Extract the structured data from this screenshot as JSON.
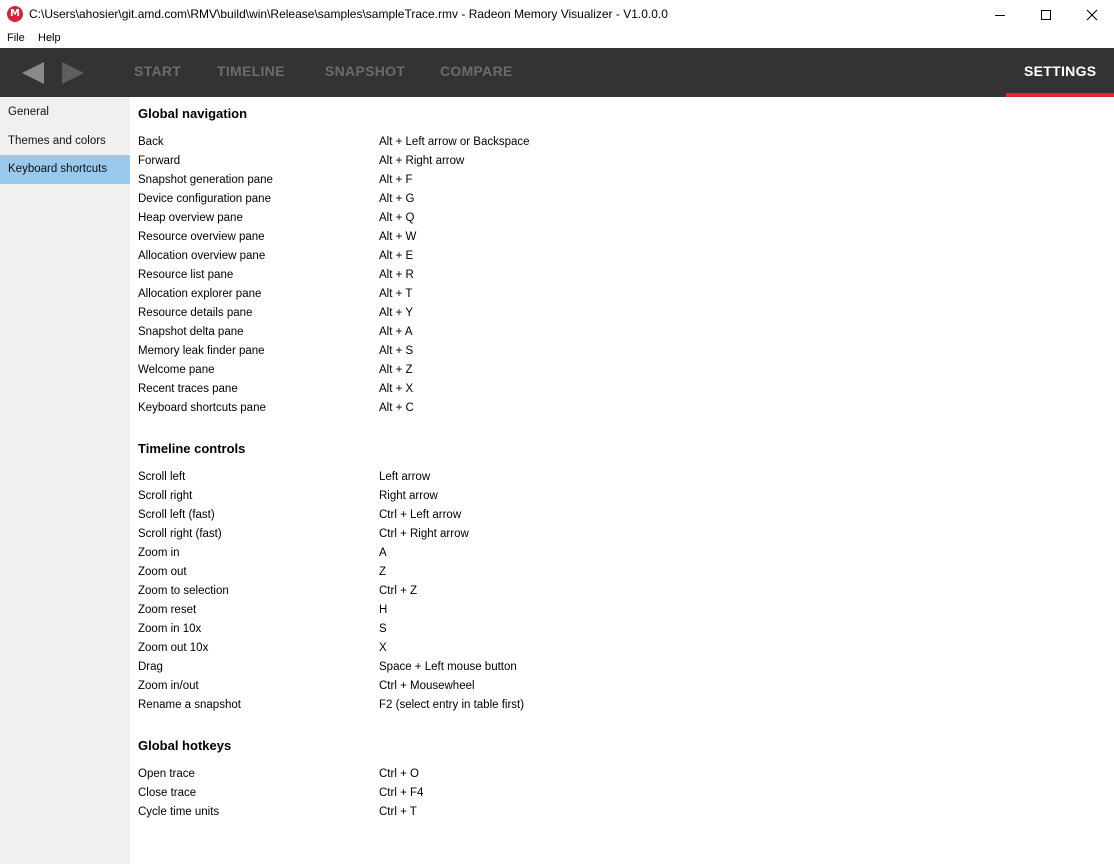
{
  "window": {
    "title": "C:\\Users\\ahosier\\git.amd.com\\RMV\\build\\win\\Release\\samples\\sampleTrace.rmv - Radeon Memory Visualizer - V1.0.0.0",
    "app_icon_letter": "M",
    "icons": {
      "app": "radeon-memory-visualizer-icon",
      "minimize": "minimize-icon",
      "maximize": "maximize-icon",
      "close": "close-icon"
    }
  },
  "menu": {
    "file": "File",
    "help": "Help"
  },
  "nav": {
    "back_icon": "back-arrow-icon",
    "forward_icon": "forward-arrow-icon",
    "tabs": [
      "START",
      "TIMELINE",
      "SNAPSHOT",
      "COMPARE"
    ],
    "settings": "SETTINGS",
    "active_tab": "SETTINGS",
    "colors": {
      "bar": "#333333",
      "active_underline": "#e0263c",
      "inactive_tab": "#6b6b6b"
    }
  },
  "sidebar": {
    "items": [
      "General",
      "Themes and colors",
      "Keyboard shortcuts"
    ],
    "selected": "Keyboard shortcuts",
    "selected_color": "#99c9ec"
  },
  "sections": [
    {
      "title": "Global navigation",
      "rows": [
        {
          "action": "Back",
          "keys": "Alt + Left arrow or Backspace"
        },
        {
          "action": "Forward",
          "keys": "Alt + Right arrow"
        },
        {
          "action": "Snapshot generation pane",
          "keys": "Alt + F"
        },
        {
          "action": "Device configuration pane",
          "keys": "Alt + G"
        },
        {
          "action": "Heap overview pane",
          "keys": "Alt + Q"
        },
        {
          "action": "Resource overview pane",
          "keys": "Alt + W"
        },
        {
          "action": "Allocation overview pane",
          "keys": "Alt + E"
        },
        {
          "action": "Resource list pane",
          "keys": "Alt + R"
        },
        {
          "action": "Allocation explorer pane",
          "keys": "Alt + T"
        },
        {
          "action": "Resource details pane",
          "keys": "Alt + Y"
        },
        {
          "action": "Snapshot delta pane",
          "keys": "Alt + A"
        },
        {
          "action": "Memory leak finder pane",
          "keys": "Alt + S"
        },
        {
          "action": "Welcome pane",
          "keys": "Alt + Z"
        },
        {
          "action": "Recent traces pane",
          "keys": "Alt + X"
        },
        {
          "action": "Keyboard shortcuts pane",
          "keys": "Alt + C"
        }
      ]
    },
    {
      "title": "Timeline controls",
      "rows": [
        {
          "action": "Scroll left",
          "keys": "Left arrow"
        },
        {
          "action": "Scroll right",
          "keys": "Right arrow"
        },
        {
          "action": "Scroll left (fast)",
          "keys": "Ctrl + Left arrow"
        },
        {
          "action": "Scroll right (fast)",
          "keys": "Ctrl + Right arrow"
        },
        {
          "action": "Zoom in",
          "keys": "A"
        },
        {
          "action": "Zoom out",
          "keys": "Z"
        },
        {
          "action": "Zoom to selection",
          "keys": "Ctrl + Z"
        },
        {
          "action": "Zoom reset",
          "keys": "H"
        },
        {
          "action": "Zoom in 10x",
          "keys": "S"
        },
        {
          "action": "Zoom out 10x",
          "keys": "X"
        },
        {
          "action": "Drag",
          "keys": "Space + Left mouse button"
        },
        {
          "action": "Zoom in/out",
          "keys": "Ctrl + Mousewheel"
        },
        {
          "action": "Rename a snapshot",
          "keys": "F2 (select entry in table first)"
        }
      ]
    },
    {
      "title": "Global hotkeys",
      "rows": [
        {
          "action": "Open trace",
          "keys": "Ctrl + O"
        },
        {
          "action": "Close trace",
          "keys": "Ctrl + F4"
        },
        {
          "action": "Cycle time units",
          "keys": "Ctrl + T"
        }
      ]
    }
  ]
}
